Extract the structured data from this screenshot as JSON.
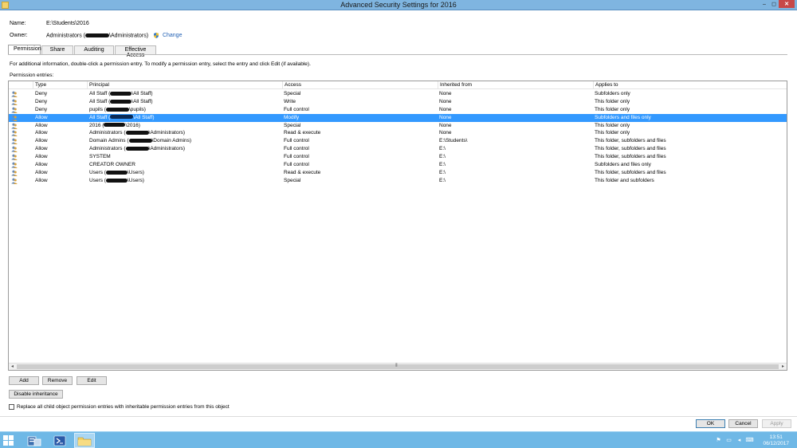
{
  "window": {
    "title": "Advanced Security Settings for 2016",
    "minimize": "–",
    "maximize": "◻",
    "close": "✕"
  },
  "header": {
    "name_label": "Name:",
    "name_value": "E:\\Students\\2016",
    "owner_label": "Owner:",
    "owner_prefix": "Administrators (",
    "owner_suffix": "\\Administrators)",
    "change_link": "Change"
  },
  "tabs": [
    "Permissions",
    "Share",
    "Auditing",
    "Effective Access"
  ],
  "description": "For additional information, double-click a permission entry. To modify a permission entry, select the entry and click Edit (if available).",
  "entries_label": "Permission entries:",
  "columns": {
    "type": "Type",
    "principal": "Principal",
    "access": "Access",
    "inherited": "Inherited from",
    "applies": "Applies to"
  },
  "entries": [
    {
      "type": "Deny",
      "principal_a": "All Staff (",
      "principal_b": "\\All Staff)",
      "access": "Special",
      "inherited": "None",
      "applies": "Subfolders only",
      "selected": false
    },
    {
      "type": "Deny",
      "principal_a": "All Staff (",
      "principal_b": "\\All Staff)",
      "access": "Write",
      "inherited": "None",
      "applies": "This folder only",
      "selected": false
    },
    {
      "type": "Deny",
      "principal_a": "pupils (",
      "principal_b": "\\pupils)",
      "access": "Full control",
      "inherited": "None",
      "applies": "This folder only",
      "selected": false
    },
    {
      "type": "Allow",
      "principal_a": "All Staff (",
      "principal_b": "\\All Staff)",
      "access": "Modify",
      "inherited": "None",
      "applies": "Subfolders and files only",
      "selected": true
    },
    {
      "type": "Allow",
      "principal_a": "2016 (",
      "principal_b": "\\2016)",
      "access": "Special",
      "inherited": "None",
      "applies": "This folder only",
      "selected": false
    },
    {
      "type": "Allow",
      "principal_a": "Administrators (",
      "principal_b": "\\Administrators)",
      "access": "Read & execute",
      "inherited": "None",
      "applies": "This folder only",
      "selected": false
    },
    {
      "type": "Allow",
      "principal_a": "Domain Admins (",
      "principal_b": "\\Domain Admins)",
      "access": "Full control",
      "inherited": "E:\\Students\\",
      "applies": "This folder, subfolders and files",
      "selected": false
    },
    {
      "type": "Allow",
      "principal_a": "Administrators (",
      "principal_b": "\\Administrators)",
      "access": "Full control",
      "inherited": "E:\\",
      "applies": "This folder, subfolders and files",
      "selected": false
    },
    {
      "type": "Allow",
      "principal_a": "SYSTEM",
      "principal_b": "",
      "access": "Full control",
      "inherited": "E:\\",
      "applies": "This folder, subfolders and files",
      "selected": false
    },
    {
      "type": "Allow",
      "principal_a": "CREATOR OWNER",
      "principal_b": "",
      "access": "Full control",
      "inherited": "E:\\",
      "applies": "Subfolders and files only",
      "selected": false
    },
    {
      "type": "Allow",
      "principal_a": "Users (",
      "principal_b": "\\Users)",
      "access": "Read & execute",
      "inherited": "E:\\",
      "applies": "This folder, subfolders and files",
      "selected": false
    },
    {
      "type": "Allow",
      "principal_a": "Users (",
      "principal_b": "\\Users)",
      "access": "Special",
      "inherited": "E:\\",
      "applies": "This folder and subfolders",
      "selected": false
    }
  ],
  "buttons": {
    "add": "Add",
    "remove": "Remove",
    "edit": "Edit",
    "disable_inheritance": "Disable inheritance",
    "ok": "OK",
    "cancel": "Cancel",
    "apply": "Apply"
  },
  "replace_checkbox": {
    "label": "Replace all child object permission entries with inheritable permission entries from this object",
    "checked": false
  },
  "taskbar": {
    "time": "13:51",
    "date": "06/12/2017"
  }
}
